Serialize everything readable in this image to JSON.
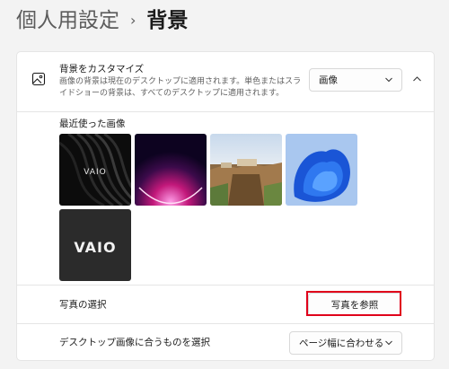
{
  "breadcrumb": {
    "parent": "個人用設定",
    "separator": "›",
    "current": "背景"
  },
  "customize": {
    "title": "背景をカスタマイズ",
    "description": "画像の背景は現在のデスクトップに適用されます。単色またはスライドショーの背景は、すべてのデスクトップに適用されます。",
    "type_value": "画像",
    "icon": "picture-icon"
  },
  "recent": {
    "title": "最近使った画像",
    "images": [
      "vaio-dark-waves",
      "purple-glow-arc",
      "cliff-town-landscape",
      "blue-bloom",
      "vaio-logo"
    ]
  },
  "photo": {
    "label": "写真の選択",
    "browse_label": "写真を参照"
  },
  "fit": {
    "label": "デスクトップ画像に合うものを選択",
    "value": "ページ幅に合わせる"
  },
  "colors": {
    "highlight": "#e0001b",
    "background": "#f3f3f3"
  }
}
